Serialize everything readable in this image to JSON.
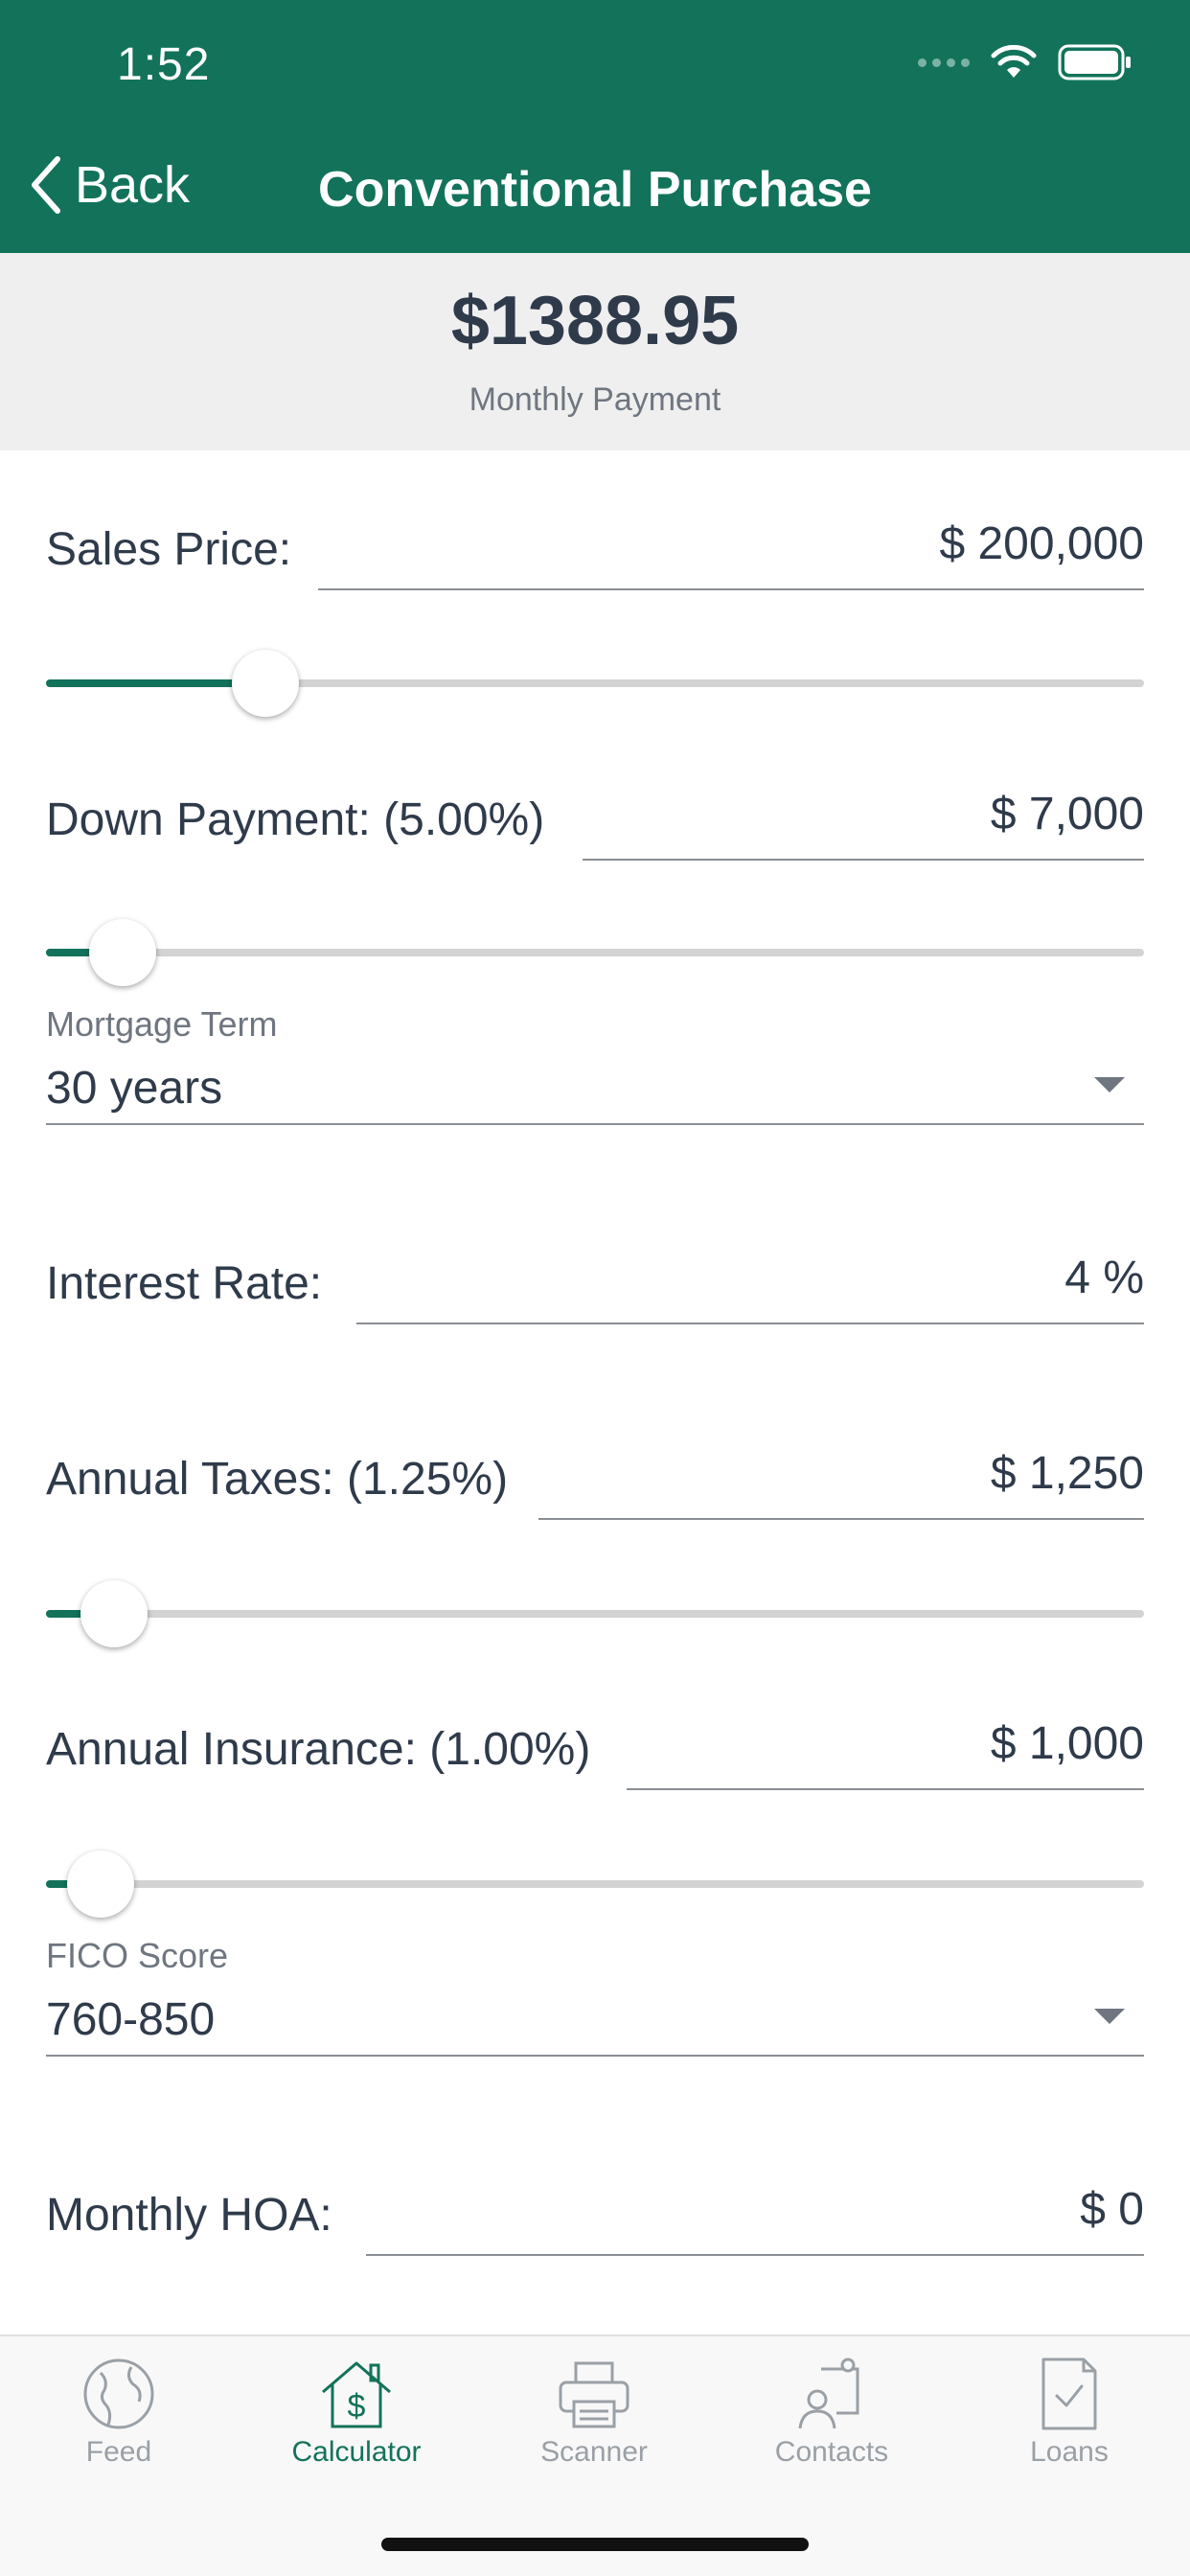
{
  "status": {
    "time": "1:52"
  },
  "nav": {
    "back_label": "Back",
    "title": "Conventional Purchase"
  },
  "summary": {
    "amount": "$1388.95",
    "label": "Monthly Payment"
  },
  "fields": {
    "sales_price": {
      "label": "Sales Price:",
      "value": "$ 200,000",
      "slider_fraction": 0.2
    },
    "down_payment": {
      "label": "Down Payment: (5.00%)",
      "value": "$ 7,000",
      "slider_fraction": 0.07
    },
    "mortgage_term": {
      "label": "Mortgage Term",
      "value": "30 years"
    },
    "interest_rate": {
      "label": "Interest Rate:",
      "value": "4 %"
    },
    "annual_taxes": {
      "label": "Annual Taxes: (1.25%)",
      "value": "$ 1,250",
      "slider_fraction": 0.062
    },
    "annual_insurance": {
      "label": "Annual Insurance: (1.00%)",
      "value": "$ 1,000",
      "slider_fraction": 0.05
    },
    "fico_score": {
      "label": "FICO Score",
      "value": "760-850"
    },
    "monthly_hoa": {
      "label": "Monthly HOA:",
      "value": "$ 0"
    }
  },
  "tabs": [
    {
      "label": "Feed",
      "icon": "globe-icon",
      "active": false
    },
    {
      "label": "Calculator",
      "icon": "house-dollar-icon",
      "active": true
    },
    {
      "label": "Scanner",
      "icon": "printer-icon",
      "active": false
    },
    {
      "label": "Contacts",
      "icon": "contacts-icon",
      "active": false
    },
    {
      "label": "Loans",
      "icon": "document-check-icon",
      "active": false
    }
  ],
  "colors": {
    "brand": "#12735a",
    "text": "#2f3b4b",
    "muted": "#6f7680",
    "track": "#d3d3d3"
  }
}
